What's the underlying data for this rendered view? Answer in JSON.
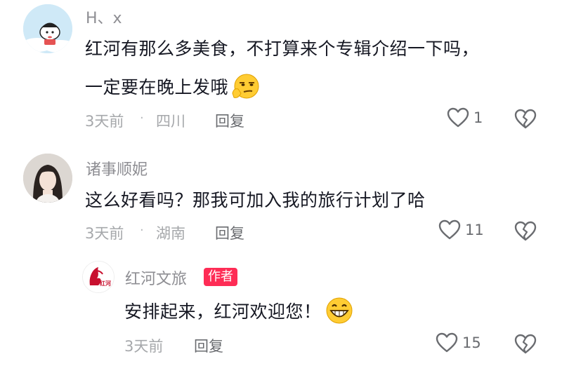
{
  "comments": [
    {
      "username": "H、x",
      "text_line1": "红河有那么多美食，不打算来个专辑介绍一下吗，",
      "text_line2": "一定要在晚上发哦",
      "time": "3天前",
      "location": "四川",
      "reply_label": "回复",
      "likes": "1"
    },
    {
      "username": "诸事顺妮",
      "text": "这么好看吗？那我可加入我的旅行计划了哈",
      "time": "3天前",
      "location": "湖南",
      "reply_label": "回复",
      "likes": "11"
    },
    {
      "username": "红河文旅",
      "badge": "作者",
      "text": "安排起来，红河欢迎您！",
      "time": "3天前",
      "reply_label": "回复",
      "likes": "15",
      "avatar_text": "红河"
    }
  ],
  "separator": "·",
  "icons": {
    "like": "heart-outline-icon",
    "dislike": "broken-heart-icon",
    "emoji1": "smirk-thinking-emoji",
    "emoji2": "grin-emoji"
  },
  "colors": {
    "text": "#161823",
    "muted": "#a6a8ab",
    "badge": "#fe2c55"
  }
}
